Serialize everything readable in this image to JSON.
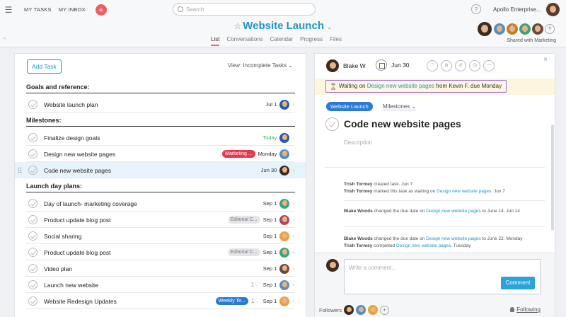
{
  "topbar": {
    "my_tasks": "MY TASKS",
    "my_inbox": "MY INBOX",
    "add_label": "+",
    "search_placeholder": "Search",
    "help_label": "?",
    "org_name": "Apollo Enterprise..."
  },
  "project": {
    "title": "Website Launch",
    "star_icon": "star-icon",
    "tabs": [
      "List",
      "Conversations",
      "Calendar",
      "Progress",
      "Files"
    ],
    "active_tab": "List",
    "shared_label": "Shared with Marketing",
    "add_member_label": "+"
  },
  "list": {
    "add_task_label": "Add Task",
    "view_label": "View: Incomplete Tasks ⌄",
    "sections": [
      {
        "title": "Goals and reference:"
      },
      {
        "title": "Milestones:"
      },
      {
        "title": "Launch day plans:"
      }
    ],
    "tasks": [
      {
        "name": "Website launch plan",
        "due": "Jul 1",
        "tag": "",
        "heart": ""
      },
      {
        "name": "Finalize design goals",
        "due": "Today",
        "tag": "",
        "heart": ""
      },
      {
        "name": "Design new website pages",
        "due": "Monday",
        "tag": "Marketing ...",
        "heart": ""
      },
      {
        "name": "Code new website pages",
        "due": "Jun 30",
        "tag": "",
        "heart": ""
      },
      {
        "name": "Day of launch- marketing coverage",
        "due": "Sep 1",
        "tag": "",
        "heart": ""
      },
      {
        "name": "Product update blog post",
        "due": "Sep 1",
        "tag": "Editorial C...",
        "heart": ""
      },
      {
        "name": "Social sharing",
        "due": "Sep 1",
        "tag": "",
        "heart": ""
      },
      {
        "name": "Product update blog post",
        "due": "Sep 1",
        "tag": "Editorial C...",
        "heart": ""
      },
      {
        "name": "Video plan",
        "due": "Sep 1",
        "tag": "",
        "heart": ""
      },
      {
        "name": "Launch new website",
        "due": "Sep 1",
        "tag": "",
        "heart": "1♡"
      },
      {
        "name": "Website Redesign Updates",
        "due": "Sep 1",
        "tag": "Weekly Te...",
        "heart": "1♡"
      }
    ]
  },
  "detail": {
    "assignee": "Blake W",
    "due": "Jun 30",
    "waiting_prefix": "Waiting on ",
    "waiting_link": "Design new website pages",
    "waiting_suffix": " from Kevin F. due Monday",
    "project_pill": "Website Launch",
    "section_dropdown": "Milestones ⌄",
    "task_title": "Code new website pages",
    "description_placeholder": "Description",
    "story1_name": "Trish Tormey",
    "story1_text": " created task.  Jun 7",
    "story2_name": "Trish Tormey",
    "story2_text": " marked this task as waiting on ",
    "story2_link": "Design new website pages",
    "story2_date": ".  Jun 7",
    "story3_name": "Blake Woods",
    "story3_text": " changed the due date on ",
    "story3_link": "Design new website pages",
    "story3_date": " to June 14.  Jun 14",
    "story4_name": "Blake Woods",
    "story4_text": " changed the due date on ",
    "story4_link": "Design new website pages",
    "story4_date": " to June 22.  Monday",
    "story5_name": "Trish Tormey",
    "story5_text": " completed ",
    "story5_link": "Design new website pages",
    "story5_date": ".  Tuesday",
    "comment_placeholder": "Write a comment...",
    "comment_button": "Comment",
    "followers_label": "Followers",
    "following_label": "Following",
    "close_label": "×"
  },
  "colors": {
    "accent": "#2196c9",
    "tab_underline": "#f06a6a",
    "marketing_tag": "#e8384f",
    "weekly_tag": "#2b7bd6",
    "today_green": "#3eb46a"
  }
}
